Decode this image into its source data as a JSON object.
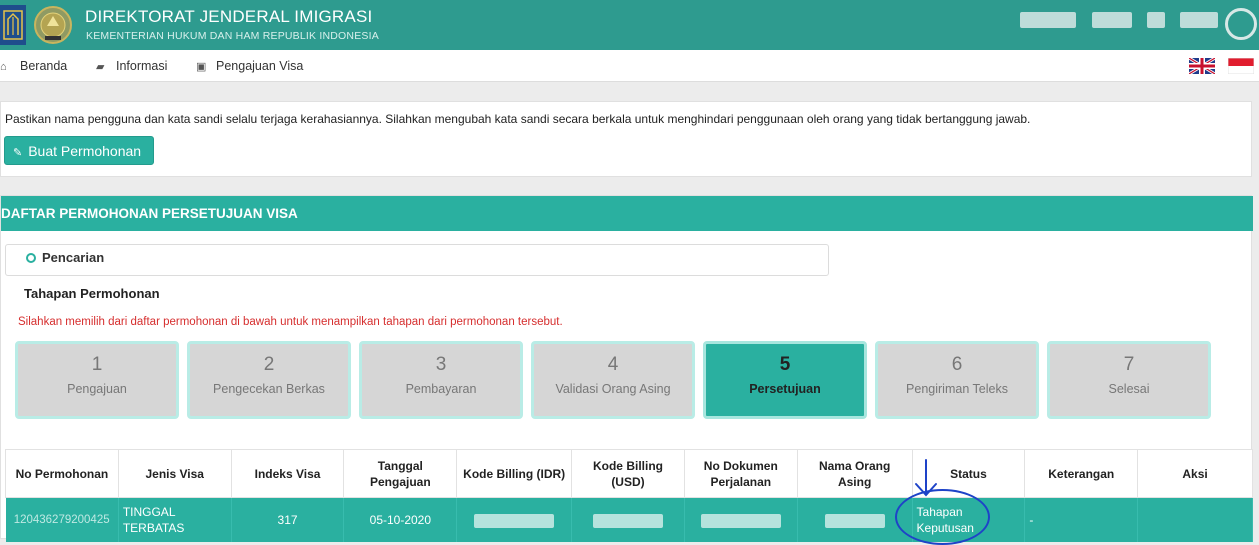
{
  "header": {
    "title": "DIREKTORAT JENDERAL IMIGRASI",
    "subtitle": "KEMENTERIAN HUKUM DAN HAM REPUBLIK INDONESIA"
  },
  "nav": {
    "items": [
      {
        "label": "Beranda",
        "icon": "home-icon"
      },
      {
        "label": "Informasi",
        "icon": "book-icon"
      },
      {
        "label": "Pengajuan Visa",
        "icon": "id-card-icon"
      }
    ],
    "languages": [
      "uk-flag-icon",
      "id-flag-icon"
    ]
  },
  "info": {
    "message": "Pastikan nama pengguna dan kata sandi selalu terjaga kerahasiannya. Silahkan mengubah kata sandi secara berkala untuk menghindari penggunaan oleh orang yang tidak bertanggung jawab.",
    "create_button": "Buat Permohonan"
  },
  "list": {
    "heading": "DAFTAR PERMOHONAN PERSETUJUAN VISA",
    "search_label": "Pencarian",
    "steps_title": "Tahapan Permohonan",
    "steps_hint": "Silahkan memilih dari daftar permohonan di bawah untuk menampilkan tahapan dari permohonan tersebut.",
    "steps": [
      {
        "num": "1",
        "label": "Pengajuan"
      },
      {
        "num": "2",
        "label": "Pengecekan Berkas"
      },
      {
        "num": "3",
        "label": "Pembayaran"
      },
      {
        "num": "4",
        "label": "Validasi Orang Asing"
      },
      {
        "num": "5",
        "label": "Persetujuan"
      },
      {
        "num": "6",
        "label": "Pengiriman Teleks"
      },
      {
        "num": "7",
        "label": "Selesai"
      }
    ],
    "active_step": 5,
    "columns": [
      "No Permohonan",
      "Jenis Visa",
      "Indeks Visa",
      "Tanggal Pengajuan",
      "Kode Billing (IDR)",
      "Kode Billing (USD)",
      "No Dokumen Perjalanan",
      "Nama Orang Asing",
      "Status",
      "Keterangan",
      "Aksi"
    ],
    "rows": [
      {
        "no_permohonan": "120436279200425",
        "jenis_visa": "TINGGAL TERBATAS",
        "indeks_visa": "317",
        "tanggal": "05-10-2020",
        "status": "Tahapan Keputusan",
        "keterangan": "-"
      }
    ]
  },
  "colors": {
    "primary": "#2ab0a0",
    "header": "#2e9b8f",
    "hint": "#d62e2e",
    "annotation": "#1e43c8"
  }
}
